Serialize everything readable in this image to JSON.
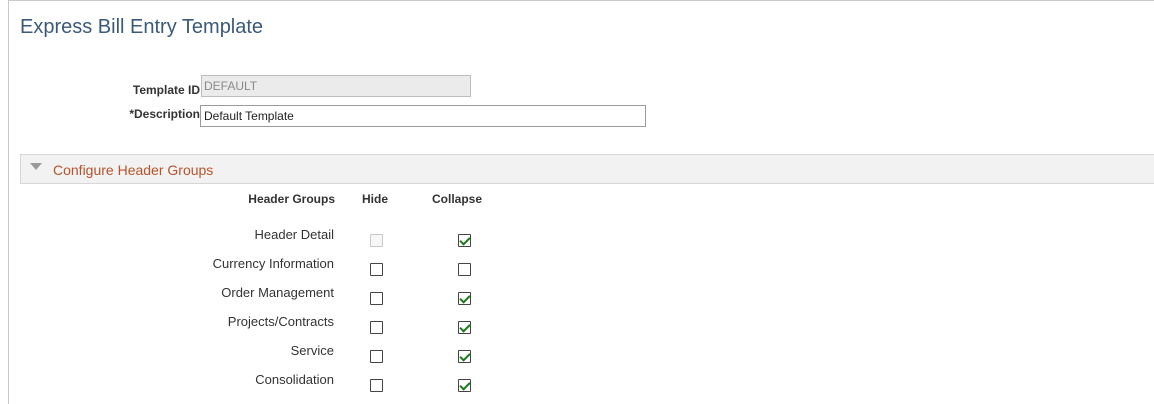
{
  "page": {
    "title": "Express Bill Entry Template"
  },
  "form": {
    "template_id_label": "Template ID",
    "template_id_value": "DEFAULT",
    "description_label": "*Description",
    "description_value": "Default Template"
  },
  "section": {
    "title": "Configure Header Groups",
    "expanded": true,
    "columns": {
      "header_groups": "Header Groups",
      "hide": "Hide",
      "collapse": "Collapse"
    },
    "rows": [
      {
        "label": "Header Detail",
        "hide": false,
        "hide_disabled": true,
        "collapse": true
      },
      {
        "label": "Currency Information",
        "hide": false,
        "hide_disabled": false,
        "collapse": false
      },
      {
        "label": "Order Management",
        "hide": false,
        "hide_disabled": false,
        "collapse": true
      },
      {
        "label": "Projects/Contracts",
        "hide": false,
        "hide_disabled": false,
        "collapse": true
      },
      {
        "label": "Service",
        "hide": false,
        "hide_disabled": false,
        "collapse": true
      },
      {
        "label": "Consolidation",
        "hide": false,
        "hide_disabled": false,
        "collapse": true
      }
    ]
  },
  "colors": {
    "title": "#3b5a7a",
    "section_title": "#b5532b",
    "check": "#1a7a1a"
  }
}
